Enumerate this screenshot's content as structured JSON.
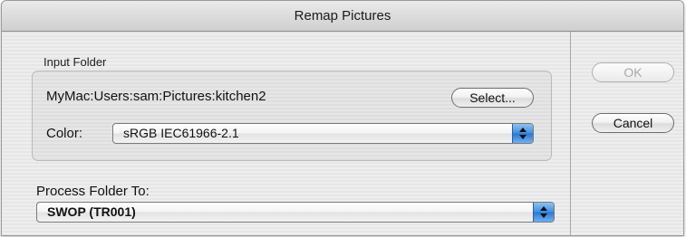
{
  "window": {
    "title": "Remap Pictures"
  },
  "input_folder": {
    "group_label": "Input Folder",
    "path": "MyMac:Users:sam:Pictures:kitchen2",
    "select_label": "Select...",
    "color_label": "Color:",
    "color_value": "sRGB IEC61966-2.1"
  },
  "process": {
    "label": "Process Folder To:",
    "value": "SWOP (TR001)"
  },
  "buttons": {
    "ok": "OK",
    "cancel": "Cancel"
  }
}
